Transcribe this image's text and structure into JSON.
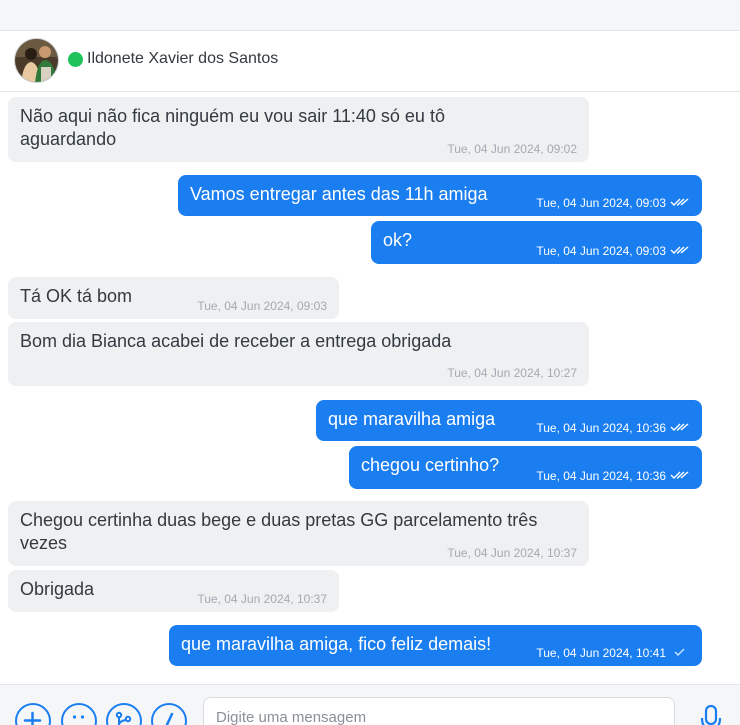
{
  "header": {
    "contact_name": "Ildonete Xavier dos Santos",
    "status": "online",
    "status_color": "#1fc35c"
  },
  "colors": {
    "outgoing_bubble": "#1a7ef0",
    "incoming_bubble": "#eef0f2",
    "accent": "#1a7ef0"
  },
  "messages": [
    {
      "dir": "in",
      "text": [
        "Não aqui não fica ninguém eu vou sair 11:40 só eu tô",
        "aguardando"
      ],
      "time": "Tue, 04 Jun 2024, 09:02"
    },
    {
      "dir": "out",
      "text": [
        "Vamos entregar antes das 11h amiga"
      ],
      "time": "Tue, 04 Jun 2024, 09:03",
      "status": "read"
    },
    {
      "dir": "out",
      "text": [
        "ok?"
      ],
      "time": "Tue, 04 Jun 2024, 09:03",
      "status": "read"
    },
    {
      "dir": "in",
      "text": [
        "Tá OK tá bom"
      ],
      "time": "Tue, 04 Jun 2024, 09:03"
    },
    {
      "dir": "in",
      "text": [
        "Bom dia Bianca acabei de receber a entrega obrigada"
      ],
      "time": "Tue, 04 Jun 2024, 10:27"
    },
    {
      "dir": "out",
      "text": [
        "que maravilha amiga"
      ],
      "time": "Tue, 04 Jun 2024, 10:36",
      "status": "read"
    },
    {
      "dir": "out",
      "text": [
        "chegou certinho?"
      ],
      "time": "Tue, 04 Jun 2024, 10:36",
      "status": "read"
    },
    {
      "dir": "in",
      "text": [
        "Chegou certinha duas bege e duas pretas GG parcelamento três",
        "vezes"
      ],
      "time": "Tue, 04 Jun 2024, 10:37"
    },
    {
      "dir": "in",
      "text": [
        "Obrigada"
      ],
      "time": "Tue, 04 Jun 2024, 10:37"
    },
    {
      "dir": "out",
      "text": [
        "que maravilha amiga, fico feliz demais!"
      ],
      "time": "Tue, 04 Jun 2024, 10:41",
      "status": "sent"
    }
  ],
  "composer": {
    "placeholder": "Digite uma mensagem",
    "value": "",
    "buttons": [
      "plus-icon",
      "emoji-icon",
      "branch-icon",
      "slash-icon"
    ],
    "mic_icon": "microphone-icon"
  }
}
